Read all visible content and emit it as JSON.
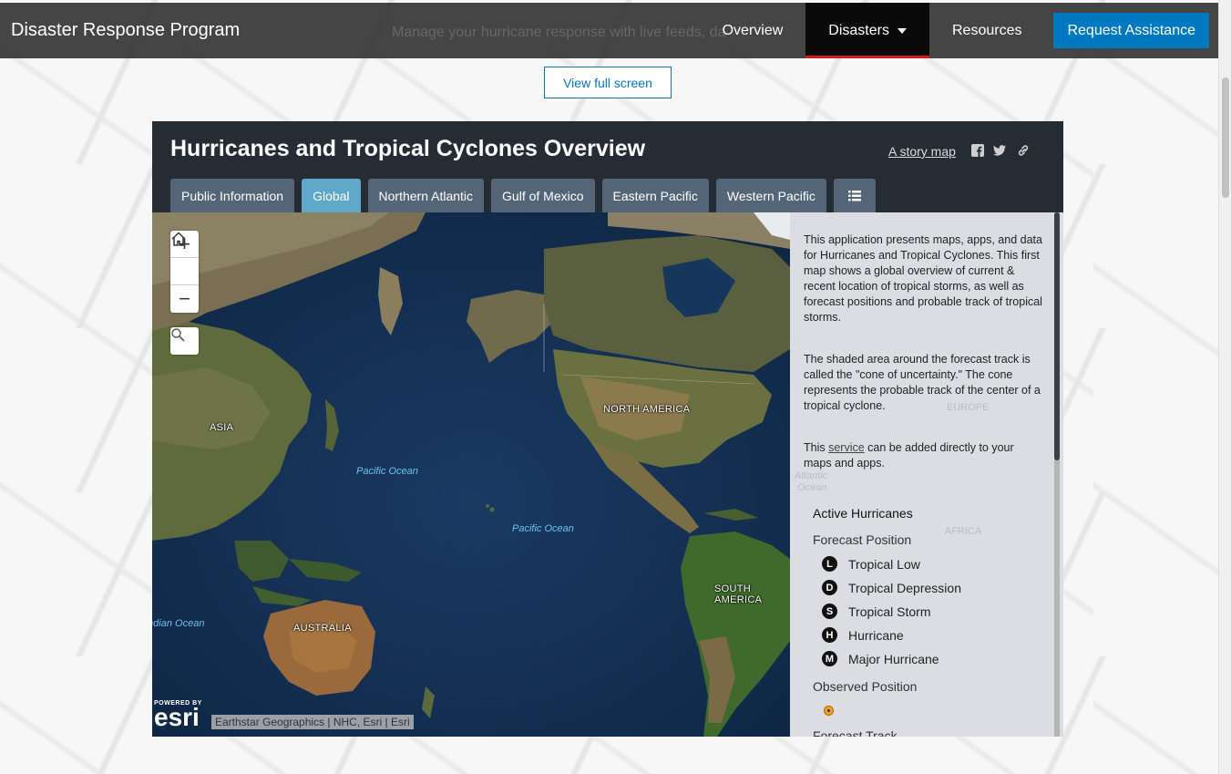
{
  "navbar": {
    "brand": "Disaster Response Program",
    "ghost_text": "Manage your hurricane response with live feeds, da",
    "items": [
      {
        "label": "Overview"
      },
      {
        "label": "Disasters",
        "active": true
      },
      {
        "label": "Resources"
      }
    ],
    "cta": "Request Assistance"
  },
  "fullscreen_button": "View full screen",
  "story": {
    "title": "Hurricanes and Tropical Cyclones Overview",
    "story_link": "A story map",
    "social_icons": [
      "facebook-icon",
      "twitter-icon",
      "link-icon"
    ],
    "tabs": [
      {
        "label": "Public Information"
      },
      {
        "label": "Global",
        "active": true
      },
      {
        "label": "Northern Atlantic"
      },
      {
        "label": "Gulf of Mexico"
      },
      {
        "label": "Eastern Pacific"
      },
      {
        "label": "Western Pacific"
      }
    ]
  },
  "map": {
    "controls": {
      "zoom_in": "+",
      "home": "home-icon",
      "zoom_out": "−",
      "search": "search-icon"
    },
    "labels": {
      "asia": "ASIA",
      "north_america": "NORTH AMERICA",
      "south_america": "SOUTH AMERICA",
      "australia": "AUSTRALIA",
      "pacific_1": "Pacific Ocean",
      "pacific_2": "Pacific Ocean",
      "indian": "Indian Ocean"
    },
    "esri": {
      "powered_by": "POWERED BY",
      "logo": "esri"
    },
    "attribution": "Earthstar Geographics | NHC, Esri | Esri"
  },
  "panel": {
    "para1": "This application presents maps, apps, and data for Hurricanes and Tropical Cyclones. This first map shows a global overview of current & recent location of tropical storms, as well as forecast positions and probable track of tropical storms.",
    "para2": "The shaded area around the forecast track is called the \"cone of uncertainty.\" The cone represents the probable track of the center of a tropical cyclone.",
    "para3_prefix": "This ",
    "para3_link": "service",
    "para3_suffix": " can be added directly to your maps and apps.",
    "ghost_labels": {
      "europe": "EUROPE",
      "atlantic_1": "Atlantic",
      "atlantic_2": "Ocean",
      "africa": "AFRICA"
    },
    "legend": {
      "heading": "Active Hurricanes",
      "forecast_position": "Forecast Position",
      "items": [
        {
          "symbol": "L",
          "label": "Tropical Low"
        },
        {
          "symbol": "D",
          "label": "Tropical Depression"
        },
        {
          "symbol": "S",
          "label": "Tropical Storm"
        },
        {
          "symbol": "H",
          "label": "Hurricane"
        },
        {
          "symbol": "M",
          "label": "Major Hurricane"
        }
      ],
      "observed_position": "Observed Position",
      "forecast_track": "Forecast Track"
    }
  },
  "colors": {
    "accent": "#0079c1",
    "active_tab": "#5fa8c9",
    "nav_active_border": "#d81a1a"
  }
}
